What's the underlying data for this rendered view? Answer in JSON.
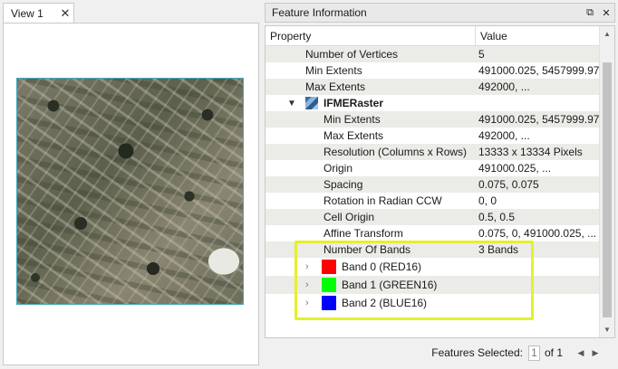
{
  "view": {
    "tab_label": "View 1",
    "close_glyph": "✕"
  },
  "feature_info": {
    "title": "Feature Information",
    "restore_glyph": "⧉",
    "close_glyph": "✕",
    "columns": {
      "property": "Property",
      "value": "Value"
    },
    "rows": [
      {
        "prop": "Number of Vertices",
        "value": "5"
      },
      {
        "prop": "Min Extents",
        "value": "491000.025, 5457999.975"
      },
      {
        "prop": "Max Extents",
        "value": "492000, ..."
      }
    ],
    "raster": {
      "label": "IFMERaster",
      "icon": "raster-icon",
      "rows": [
        {
          "prop": "Min Extents",
          "value": "491000.025, 5457999.975"
        },
        {
          "prop": "Max Extents",
          "value": "492000, ..."
        },
        {
          "prop": "Resolution (Columns x Rows)",
          "value": "13333 x 13334 Pixels"
        },
        {
          "prop": "Origin",
          "value": "491000.025, ..."
        },
        {
          "prop": "Spacing",
          "value": "0.075, 0.075"
        },
        {
          "prop": "Rotation in Radian CCW",
          "value": "0, 0"
        },
        {
          "prop": "Cell Origin",
          "value": "0.5, 0.5"
        },
        {
          "prop": "Affine Transform",
          "value": "0.075, 0, 491000.025, ..."
        },
        {
          "prop": "Number Of Bands",
          "value": "3 Bands"
        }
      ],
      "bands": [
        {
          "label": "Band 0 (RED16)",
          "color": "#ff0000"
        },
        {
          "label": "Band 1 (GREEN16)",
          "color": "#00ff00"
        },
        {
          "label": "Band 2 (BLUE16)",
          "color": "#0000ff"
        }
      ]
    },
    "highlight_color": "#e4f02c"
  },
  "footer": {
    "features_selected_label": "Features Selected:",
    "page_value": "1",
    "of_label": "of 1"
  }
}
